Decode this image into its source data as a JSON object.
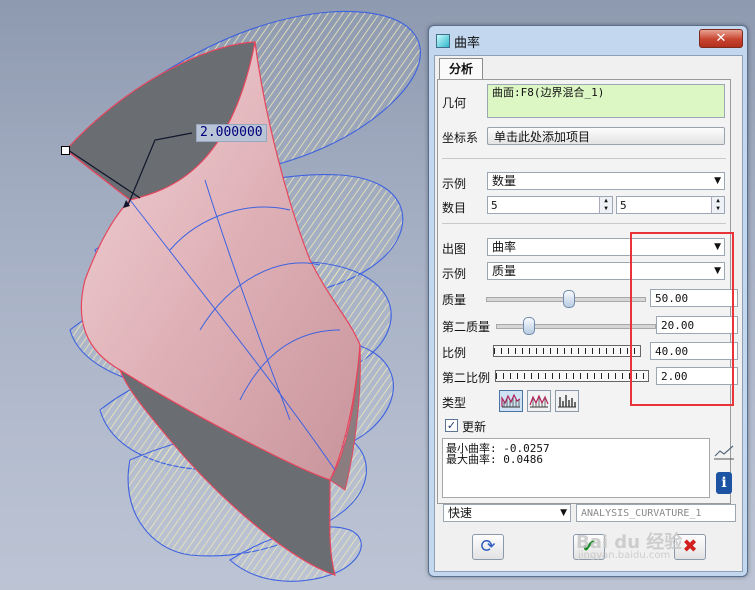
{
  "viewport": {
    "dimension_value": "2.000000"
  },
  "dialog": {
    "title": "曲率",
    "close_glyph": "✕",
    "tab": "分析",
    "geometry": {
      "label": "几何",
      "value": "曲面:F8(边界混合_1)"
    },
    "coordsys": {
      "label": "坐标系",
      "button": "单击此处添加项目"
    },
    "instance1": {
      "label": "示例",
      "value": "数量"
    },
    "count": {
      "label": "数目",
      "value1": "5",
      "value2": "5"
    },
    "output": {
      "label": "出图",
      "value": "曲率"
    },
    "instance2": {
      "label": "示例",
      "value": "质量"
    },
    "quality": {
      "label": "质量",
      "value": "50.00",
      "slider_fraction": 0.52
    },
    "quality2": {
      "label": "第二质量",
      "value": "20.00",
      "slider_fraction": 0.2
    },
    "scale": {
      "label": "比例",
      "value": "40.00"
    },
    "scale2": {
      "label": "第二比例",
      "value": "2.00"
    },
    "type": {
      "label": "类型"
    },
    "update": {
      "label": "更新",
      "checked": true
    },
    "results": {
      "line1": "最小曲率: -0.0257",
      "line2": "最大曲率: 0.0486"
    },
    "mode": {
      "value": "快速"
    },
    "analysis_name": {
      "value": "ANALYSIS_CURVATURE_1"
    },
    "ok_glyph": "✔",
    "cancel_glyph": "✖"
  },
  "watermark": {
    "brand": "Bai du 经验",
    "url": "jingyan.baidu.com"
  },
  "colors": {
    "highlight_box": "#e8333a",
    "geometry_field": "#dcf6c4",
    "surface": "#e5b9c0"
  }
}
